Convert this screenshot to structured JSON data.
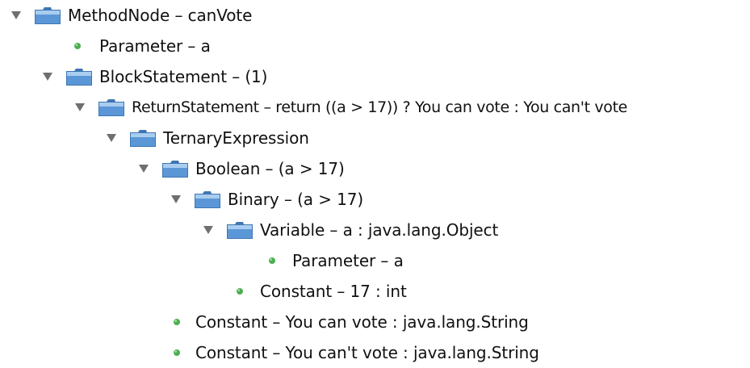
{
  "tree": {
    "rows": [
      {
        "depth": 0,
        "kind": "branch",
        "expanded": true,
        "label": "MethodNode – canVote"
      },
      {
        "depth": 1,
        "kind": "leaf",
        "label": "Parameter – a"
      },
      {
        "depth": 1,
        "kind": "branch",
        "expanded": true,
        "label": "BlockStatement – (1)"
      },
      {
        "depth": 2,
        "kind": "branch",
        "expanded": true,
        "label": "ReturnStatement – return ((a > 17)) ? You can vote : You can't vote"
      },
      {
        "depth": 3,
        "kind": "branch",
        "expanded": true,
        "label": "TernaryExpression"
      },
      {
        "depth": 4,
        "kind": "branch",
        "expanded": true,
        "label": "Boolean – (a > 17)"
      },
      {
        "depth": 5,
        "kind": "branch",
        "expanded": true,
        "label": "Binary – (a > 17)"
      },
      {
        "depth": 6,
        "kind": "branch",
        "expanded": true,
        "label": "Variable – a : java.lang.Object"
      },
      {
        "depth": 7,
        "kind": "leaf",
        "label": "Parameter – a"
      },
      {
        "depth": 6,
        "kind": "leaf",
        "label": "Constant – 17 : int"
      },
      {
        "depth": 4,
        "kind": "leaf",
        "label": "Constant – You can vote : java.lang.String"
      },
      {
        "depth": 4,
        "kind": "leaf",
        "label": "Constant – You can't vote : java.lang.String"
      }
    ]
  },
  "icons": {
    "toggle_expanded": "triangle-down-icon",
    "folder": "folder-icon",
    "leaf": "green-dot-icon"
  },
  "colors": {
    "toggle": "#6f6f6f",
    "folder_body": "#5b97d6",
    "folder_light": "#a9cdf0",
    "folder_edge": "#3d76b4",
    "leaf_dot": "#4caf50",
    "text": "#111111"
  }
}
